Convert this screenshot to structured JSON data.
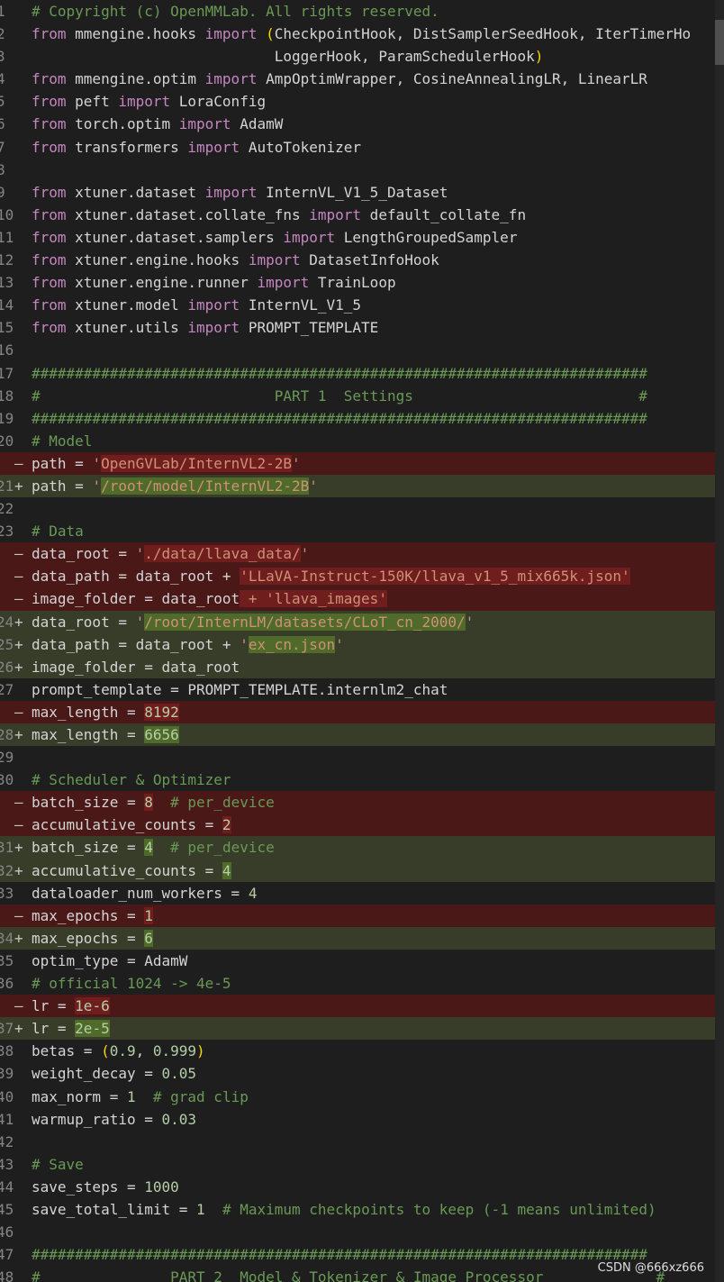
{
  "watermark": "CSDN @666xz666",
  "lines": [
    {
      "n": "1",
      "type": "normal",
      "mark": "",
      "segs": [
        {
          "t": "# Copyright (c) OpenMMLab. All rights reserved.",
          "c": "cm"
        }
      ]
    },
    {
      "n": "2",
      "type": "normal",
      "mark": "",
      "segs": [
        {
          "t": "from",
          "c": "kw"
        },
        {
          "t": " mmengine.hooks ",
          "c": ""
        },
        {
          "t": "import",
          "c": "kw"
        },
        {
          "t": " ",
          "c": ""
        },
        {
          "t": "(",
          "c": "pn"
        },
        {
          "t": "CheckpointHook, DistSamplerSeedHook, IterTimerHo",
          "c": ""
        }
      ]
    },
    {
      "n": "3",
      "type": "normal",
      "mark": "",
      "segs": [
        {
          "t": "                            LoggerHook, ParamSchedulerHook",
          "c": ""
        },
        {
          "t": ")",
          "c": "pn"
        }
      ]
    },
    {
      "n": "4",
      "type": "normal",
      "mark": "",
      "segs": [
        {
          "t": "from",
          "c": "kw"
        },
        {
          "t": " mmengine.optim ",
          "c": ""
        },
        {
          "t": "import",
          "c": "kw"
        },
        {
          "t": " AmpOptimWrapper, CosineAnnealingLR, LinearLR",
          "c": ""
        }
      ]
    },
    {
      "n": "5",
      "type": "normal",
      "mark": "",
      "segs": [
        {
          "t": "from",
          "c": "kw"
        },
        {
          "t": " peft ",
          "c": ""
        },
        {
          "t": "import",
          "c": "kw"
        },
        {
          "t": " LoraConfig",
          "c": ""
        }
      ]
    },
    {
      "n": "6",
      "type": "normal",
      "mark": "",
      "segs": [
        {
          "t": "from",
          "c": "kw"
        },
        {
          "t": " torch.optim ",
          "c": ""
        },
        {
          "t": "import",
          "c": "kw"
        },
        {
          "t": " AdamW",
          "c": ""
        }
      ]
    },
    {
      "n": "7",
      "type": "normal",
      "mark": "",
      "segs": [
        {
          "t": "from",
          "c": "kw"
        },
        {
          "t": " transformers ",
          "c": ""
        },
        {
          "t": "import",
          "c": "kw"
        },
        {
          "t": " AutoTokenizer",
          "c": ""
        }
      ]
    },
    {
      "n": "8",
      "type": "normal",
      "mark": "",
      "segs": []
    },
    {
      "n": "9",
      "type": "normal",
      "mark": "",
      "segs": [
        {
          "t": "from",
          "c": "kw"
        },
        {
          "t": " xtuner.dataset ",
          "c": ""
        },
        {
          "t": "import",
          "c": "kw"
        },
        {
          "t": " InternVL_V1_5_Dataset",
          "c": ""
        }
      ]
    },
    {
      "n": "10",
      "type": "normal",
      "mark": "",
      "segs": [
        {
          "t": "from",
          "c": "kw"
        },
        {
          "t": " xtuner.dataset.collate_fns ",
          "c": ""
        },
        {
          "t": "import",
          "c": "kw"
        },
        {
          "t": " default_collate_fn",
          "c": ""
        }
      ]
    },
    {
      "n": "11",
      "type": "normal",
      "mark": "",
      "segs": [
        {
          "t": "from",
          "c": "kw"
        },
        {
          "t": " xtuner.dataset.samplers ",
          "c": ""
        },
        {
          "t": "import",
          "c": "kw"
        },
        {
          "t": " LengthGroupedSampler",
          "c": ""
        }
      ]
    },
    {
      "n": "12",
      "type": "normal",
      "mark": "",
      "segs": [
        {
          "t": "from",
          "c": "kw"
        },
        {
          "t": " xtuner.engine.hooks ",
          "c": ""
        },
        {
          "t": "import",
          "c": "kw"
        },
        {
          "t": " DatasetInfoHook",
          "c": ""
        }
      ]
    },
    {
      "n": "13",
      "type": "normal",
      "mark": "",
      "segs": [
        {
          "t": "from",
          "c": "kw"
        },
        {
          "t": " xtuner.engine.runner ",
          "c": ""
        },
        {
          "t": "import",
          "c": "kw"
        },
        {
          "t": " TrainLoop",
          "c": ""
        }
      ]
    },
    {
      "n": "14",
      "type": "normal",
      "mark": "",
      "segs": [
        {
          "t": "from",
          "c": "kw"
        },
        {
          "t": " xtuner.model ",
          "c": ""
        },
        {
          "t": "import",
          "c": "kw"
        },
        {
          "t": " InternVL_V1_5",
          "c": ""
        }
      ]
    },
    {
      "n": "15",
      "type": "normal",
      "mark": "",
      "segs": [
        {
          "t": "from",
          "c": "kw"
        },
        {
          "t": " xtuner.utils ",
          "c": ""
        },
        {
          "t": "import",
          "c": "kw"
        },
        {
          "t": " PROMPT_TEMPLATE",
          "c": ""
        }
      ]
    },
    {
      "n": "16",
      "type": "normal",
      "mark": "",
      "segs": []
    },
    {
      "n": "17",
      "type": "normal",
      "mark": "",
      "segs": [
        {
          "t": "#######################################################################",
          "c": "cm"
        }
      ]
    },
    {
      "n": "18",
      "type": "normal",
      "mark": "",
      "segs": [
        {
          "t": "#                           PART 1  Settings                          #",
          "c": "cm"
        }
      ]
    },
    {
      "n": "19",
      "type": "normal",
      "mark": "",
      "segs": [
        {
          "t": "#######################################################################",
          "c": "cm"
        }
      ]
    },
    {
      "n": "20",
      "type": "normal",
      "mark": "",
      "segs": [
        {
          "t": "# Model",
          "c": "cm"
        }
      ]
    },
    {
      "n": "",
      "type": "del",
      "mark": "—",
      "segs": [
        {
          "t": "path = ",
          "c": ""
        },
        {
          "t": "'",
          "c": "st"
        },
        {
          "t": "OpenGVLab/InternVL2-2B",
          "c": "st hl"
        },
        {
          "t": "'",
          "c": "st"
        }
      ]
    },
    {
      "n": "21",
      "type": "add",
      "mark": "+",
      "segs": [
        {
          "t": "path = ",
          "c": ""
        },
        {
          "t": "'",
          "c": "st"
        },
        {
          "t": "/root/model/InternVL2-2B",
          "c": "st hl"
        },
        {
          "t": "'",
          "c": "st"
        }
      ]
    },
    {
      "n": "22",
      "type": "normal",
      "mark": "",
      "segs": []
    },
    {
      "n": "23",
      "type": "normal",
      "mark": "",
      "segs": [
        {
          "t": "# Data",
          "c": "cm"
        }
      ]
    },
    {
      "n": "",
      "type": "del",
      "mark": "—",
      "segs": [
        {
          "t": "data_root = ",
          "c": ""
        },
        {
          "t": "'",
          "c": "st"
        },
        {
          "t": "./data/llava_data/",
          "c": "st hl"
        },
        {
          "t": "'",
          "c": "st"
        }
      ]
    },
    {
      "n": "",
      "type": "del",
      "mark": "—",
      "segs": [
        {
          "t": "data_path = data_root + ",
          "c": ""
        },
        {
          "t": "'LLaVA-Instruct-150K/llava_v1_5_mix665k.json'",
          "c": "st hl"
        }
      ]
    },
    {
      "n": "",
      "type": "del",
      "mark": "—",
      "segs": [
        {
          "t": "image_folder = data_root",
          "c": ""
        },
        {
          "t": " + 'llava_images'",
          "c": "st hl"
        }
      ]
    },
    {
      "n": "24",
      "type": "add",
      "mark": "+",
      "segs": [
        {
          "t": "data_root = ",
          "c": ""
        },
        {
          "t": "'",
          "c": "st"
        },
        {
          "t": "/root/InternLM/datasets/CLoT_cn_2000/",
          "c": "st hl"
        },
        {
          "t": "'",
          "c": "st"
        }
      ]
    },
    {
      "n": "25",
      "type": "add",
      "mark": "+",
      "segs": [
        {
          "t": "data_path = data_root + ",
          "c": ""
        },
        {
          "t": "'",
          "c": "st"
        },
        {
          "t": "ex_cn.json",
          "c": "st hl"
        },
        {
          "t": "'",
          "c": "st"
        }
      ]
    },
    {
      "n": "26",
      "type": "add",
      "mark": "+",
      "segs": [
        {
          "t": "image_folder = data_root",
          "c": ""
        }
      ]
    },
    {
      "n": "27",
      "type": "normal",
      "mark": "",
      "segs": [
        {
          "t": "prompt_template = PROMPT_TEMPLATE.internlm2_chat",
          "c": ""
        }
      ]
    },
    {
      "n": "",
      "type": "del",
      "mark": "—",
      "segs": [
        {
          "t": "max_length = ",
          "c": ""
        },
        {
          "t": "8192",
          "c": "nm hl"
        }
      ]
    },
    {
      "n": "28",
      "type": "add",
      "mark": "+",
      "segs": [
        {
          "t": "max_length = ",
          "c": ""
        },
        {
          "t": "6656",
          "c": "nm hl"
        }
      ]
    },
    {
      "n": "29",
      "type": "normal",
      "mark": "",
      "segs": []
    },
    {
      "n": "30",
      "type": "normal",
      "mark": "",
      "segs": [
        {
          "t": "# Scheduler & Optimizer",
          "c": "cm"
        }
      ]
    },
    {
      "n": "",
      "type": "del",
      "mark": "—",
      "segs": [
        {
          "t": "batch_size = ",
          "c": ""
        },
        {
          "t": "8",
          "c": "nm hl"
        },
        {
          "t": "  # per_device",
          "c": "cm"
        }
      ]
    },
    {
      "n": "",
      "type": "del",
      "mark": "—",
      "segs": [
        {
          "t": "accumulative_counts = ",
          "c": ""
        },
        {
          "t": "2",
          "c": "nm hl"
        }
      ]
    },
    {
      "n": "31",
      "type": "add",
      "mark": "+",
      "segs": [
        {
          "t": "batch_size = ",
          "c": ""
        },
        {
          "t": "4",
          "c": "nm hl"
        },
        {
          "t": "  # per_device",
          "c": "cm"
        }
      ]
    },
    {
      "n": "32",
      "type": "add",
      "mark": "+",
      "segs": [
        {
          "t": "accumulative_counts = ",
          "c": ""
        },
        {
          "t": "4",
          "c": "nm hl"
        }
      ]
    },
    {
      "n": "33",
      "type": "normal",
      "mark": "",
      "segs": [
        {
          "t": "dataloader_num_workers = ",
          "c": ""
        },
        {
          "t": "4",
          "c": "nm"
        }
      ]
    },
    {
      "n": "",
      "type": "del",
      "mark": "—",
      "segs": [
        {
          "t": "max_epochs = ",
          "c": ""
        },
        {
          "t": "1",
          "c": "nm hl"
        }
      ]
    },
    {
      "n": "34",
      "type": "add",
      "mark": "+",
      "segs": [
        {
          "t": "max_epochs = ",
          "c": ""
        },
        {
          "t": "6",
          "c": "nm hl"
        }
      ]
    },
    {
      "n": "35",
      "type": "normal",
      "mark": "",
      "segs": [
        {
          "t": "optim_type = AdamW",
          "c": ""
        }
      ]
    },
    {
      "n": "36",
      "type": "normal",
      "mark": "",
      "segs": [
        {
          "t": "# official 1024 -> 4e-5",
          "c": "cm"
        }
      ]
    },
    {
      "n": "",
      "type": "del",
      "mark": "—",
      "segs": [
        {
          "t": "lr = ",
          "c": ""
        },
        {
          "t": "1e-6",
          "c": "nm hl"
        }
      ]
    },
    {
      "n": "37",
      "type": "add",
      "mark": "+",
      "segs": [
        {
          "t": "lr = ",
          "c": ""
        },
        {
          "t": "2e-5",
          "c": "nm hl"
        }
      ]
    },
    {
      "n": "38",
      "type": "normal",
      "mark": "",
      "segs": [
        {
          "t": "betas = ",
          "c": ""
        },
        {
          "t": "(",
          "c": "pn"
        },
        {
          "t": "0.9",
          "c": "nm"
        },
        {
          "t": ", ",
          "c": ""
        },
        {
          "t": "0.999",
          "c": "nm"
        },
        {
          "t": ")",
          "c": "pn"
        }
      ]
    },
    {
      "n": "39",
      "type": "normal",
      "mark": "",
      "segs": [
        {
          "t": "weight_decay = ",
          "c": ""
        },
        {
          "t": "0.05",
          "c": "nm"
        }
      ]
    },
    {
      "n": "40",
      "type": "normal",
      "mark": "",
      "segs": [
        {
          "t": "max_norm = ",
          "c": ""
        },
        {
          "t": "1",
          "c": "nm"
        },
        {
          "t": "  # grad clip",
          "c": "cm"
        }
      ]
    },
    {
      "n": "41",
      "type": "normal",
      "mark": "",
      "segs": [
        {
          "t": "warmup_ratio = ",
          "c": ""
        },
        {
          "t": "0.03",
          "c": "nm"
        }
      ]
    },
    {
      "n": "42",
      "type": "normal",
      "mark": "",
      "segs": []
    },
    {
      "n": "43",
      "type": "normal",
      "mark": "",
      "segs": [
        {
          "t": "# Save",
          "c": "cm"
        }
      ]
    },
    {
      "n": "44",
      "type": "normal",
      "mark": "",
      "segs": [
        {
          "t": "save_steps = ",
          "c": ""
        },
        {
          "t": "1000",
          "c": "nm"
        }
      ]
    },
    {
      "n": "45",
      "type": "normal",
      "mark": "",
      "segs": [
        {
          "t": "save_total_limit = ",
          "c": ""
        },
        {
          "t": "1",
          "c": "nm"
        },
        {
          "t": "  # Maximum checkpoints to keep (-1 means unlimited)",
          "c": "cm"
        }
      ]
    },
    {
      "n": "46",
      "type": "normal",
      "mark": "",
      "segs": []
    },
    {
      "n": "47",
      "type": "normal",
      "mark": "",
      "segs": [
        {
          "t": "#######################################################################",
          "c": "cm"
        }
      ]
    },
    {
      "n": "48",
      "type": "normal",
      "mark": "",
      "segs": [
        {
          "t": "#               PART 2  Model & Tokenizer & Image Processor             #",
          "c": "cm"
        }
      ]
    }
  ]
}
